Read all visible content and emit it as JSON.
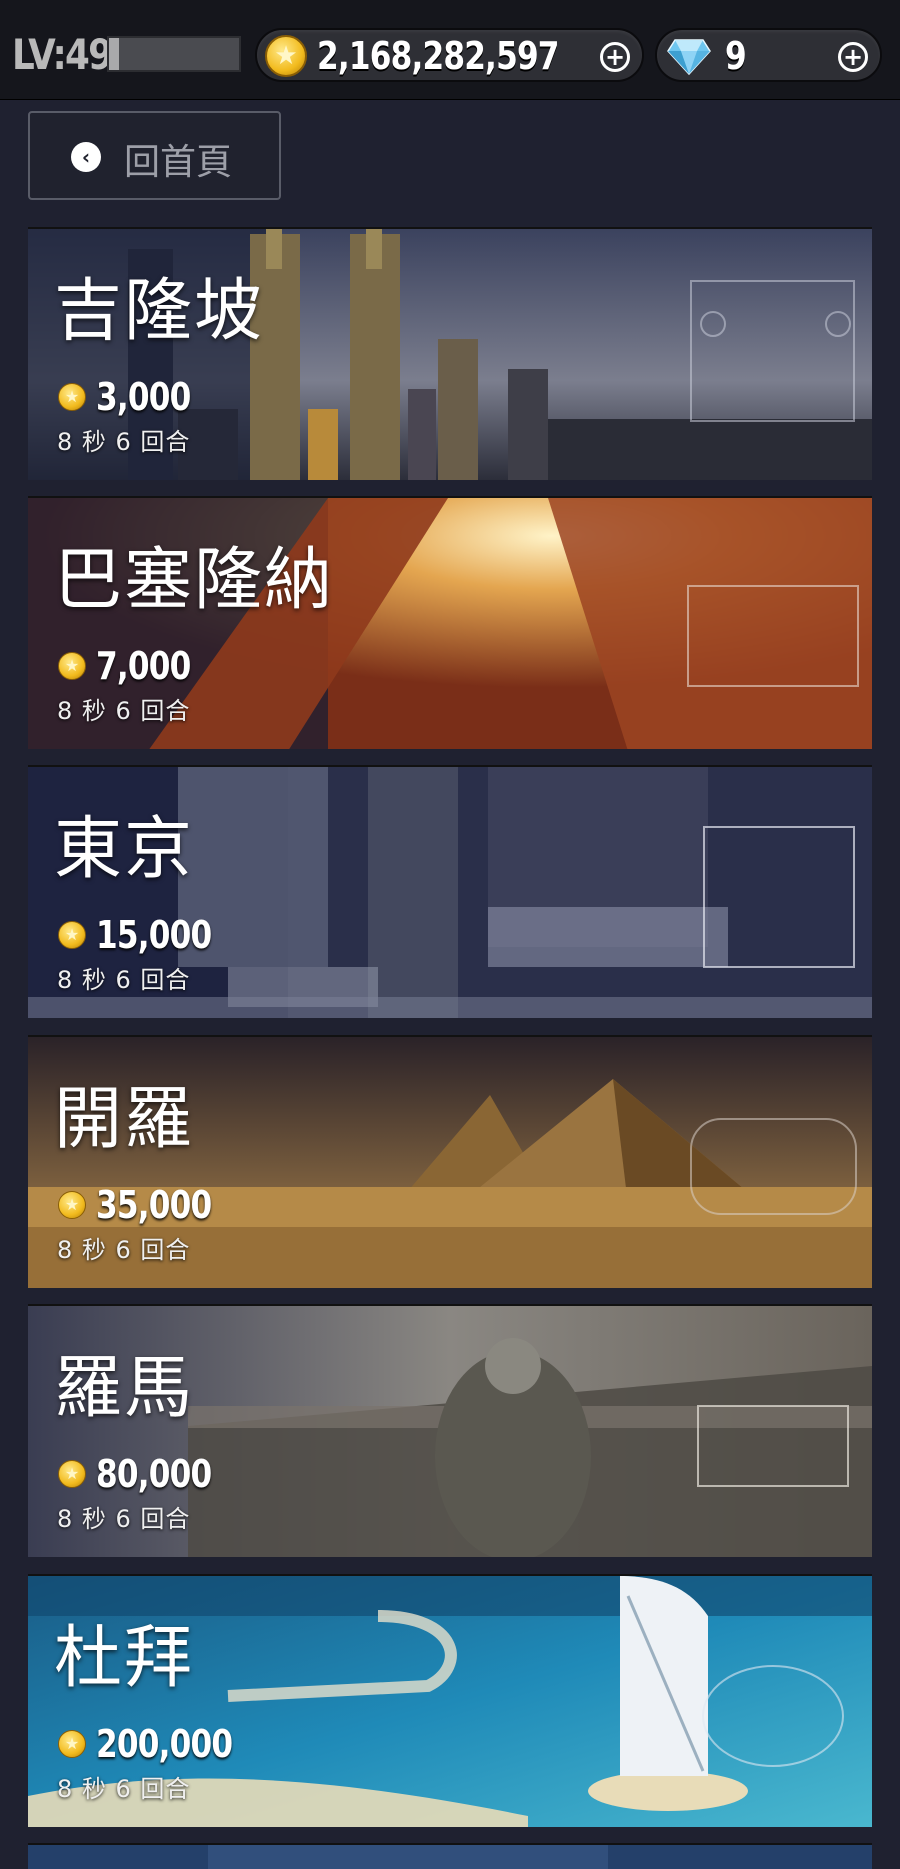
{
  "header": {
    "level_label": "LV:49",
    "xp_progress": 0.08,
    "coins": "2,168,282,597",
    "gems": "9",
    "coin_icon": "coin-icon",
    "gem_icon": "diamond-icon",
    "plus_icon": "plus-circle-icon",
    "plus_symbol": "+",
    "coin_symbol": "★"
  },
  "nav": {
    "back_label": "回首頁",
    "back_icon": "chevron-left-circle-icon",
    "back_symbol": "‹"
  },
  "cities": [
    {
      "name": "吉隆坡",
      "cost": "3,000",
      "rounds": "8 秒 6 回合"
    },
    {
      "name": "巴塞隆納",
      "cost": "7,000",
      "rounds": "8 秒 6 回合"
    },
    {
      "name": "東京",
      "cost": "15,000",
      "rounds": "8 秒 6 回合"
    },
    {
      "name": "開羅",
      "cost": "35,000",
      "rounds": "8 秒 6 回合"
    },
    {
      "name": "羅馬",
      "cost": "80,000",
      "rounds": "8 秒 6 回合"
    },
    {
      "name": "杜拜",
      "cost": "200,000",
      "rounds": "8 秒 6 回合"
    }
  ],
  "colors": {
    "background": "#1f2130",
    "topbar": "#15161c",
    "coin_gold": "#f2bb1e",
    "gem_blue": "#8fd3f5"
  }
}
